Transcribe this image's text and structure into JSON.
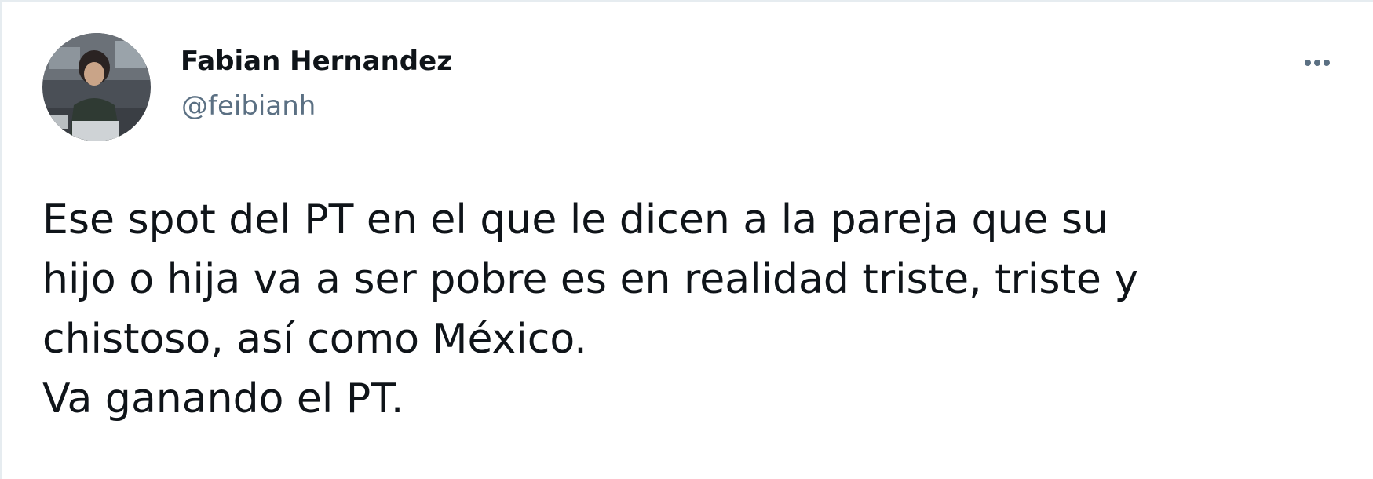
{
  "tweet": {
    "author": {
      "display_name": "Fabian Hernandez",
      "handle": "@feibianh"
    },
    "more_icon": "more-horizontal-icon",
    "text_lines": [
      "Ese spot del PT en el que le dicen a la pareja que su",
      "hijo o hija va a ser pobre es en realidad triste, triste y",
      "chistoso, así como México.",
      "Va ganando el PT."
    ]
  },
  "colors": {
    "text": "#0f1419",
    "secondary": "#5b7083",
    "border": "#e6ecf0",
    "background": "#ffffff"
  }
}
